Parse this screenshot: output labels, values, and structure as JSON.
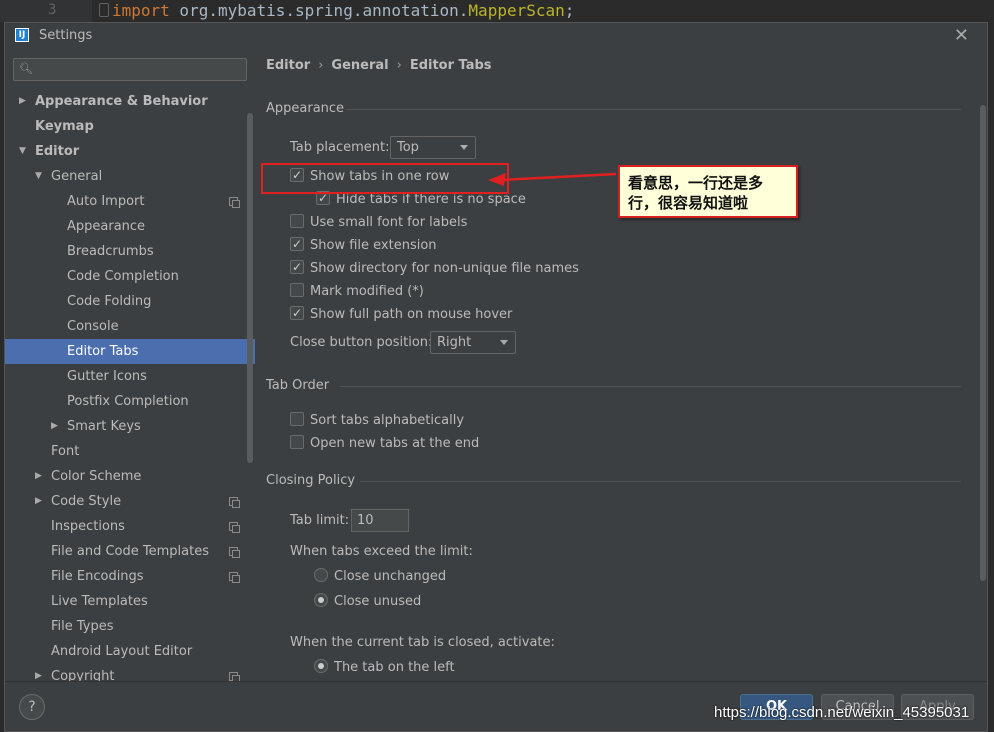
{
  "editor": {
    "line_number": "3",
    "code_keyword": "import",
    "code_package": " org.mybatis.spring.annotation.",
    "code_class": "MapperScan",
    "code_end": ";"
  },
  "window": {
    "title": "Settings",
    "app_icon": "intellij-icon"
  },
  "sidebar": {
    "search_placeholder": "",
    "items": [
      {
        "label": "Appearance & Behavior",
        "level": 0,
        "arrow": "collapsed",
        "bold": true
      },
      {
        "label": "Keymap",
        "level": 0,
        "arrow": "none",
        "bold": true
      },
      {
        "label": "Editor",
        "level": 0,
        "arrow": "expanded",
        "bold": true
      },
      {
        "label": "General",
        "level": 1,
        "arrow": "expanded"
      },
      {
        "label": "Auto Import",
        "level": 2,
        "copy_icon": true
      },
      {
        "label": "Appearance",
        "level": 2
      },
      {
        "label": "Breadcrumbs",
        "level": 2
      },
      {
        "label": "Code Completion",
        "level": 2
      },
      {
        "label": "Code Folding",
        "level": 2
      },
      {
        "label": "Console",
        "level": 2
      },
      {
        "label": "Editor Tabs",
        "level": 2,
        "selected": true
      },
      {
        "label": "Gutter Icons",
        "level": 2
      },
      {
        "label": "Postfix Completion",
        "level": 2
      },
      {
        "label": "Smart Keys",
        "level": 2,
        "arrow": "collapsed"
      },
      {
        "label": "Font",
        "level": 1
      },
      {
        "label": "Color Scheme",
        "level": 1,
        "arrow": "collapsed"
      },
      {
        "label": "Code Style",
        "level": 1,
        "arrow": "collapsed",
        "copy_icon": true
      },
      {
        "label": "Inspections",
        "level": 1,
        "copy_icon": true
      },
      {
        "label": "File and Code Templates",
        "level": 1,
        "copy_icon": true
      },
      {
        "label": "File Encodings",
        "level": 1,
        "copy_icon": true
      },
      {
        "label": "Live Templates",
        "level": 1
      },
      {
        "label": "File Types",
        "level": 1
      },
      {
        "label": "Android Layout Editor",
        "level": 1
      },
      {
        "label": "Copyright",
        "level": 1,
        "arrow": "collapsed",
        "copy_icon": true
      }
    ]
  },
  "breadcrumb": [
    "Editor",
    "General",
    "Editor Tabs"
  ],
  "breadcrumb_separator": "›",
  "appearance": {
    "title": "Appearance",
    "tab_placement_label": "Tab placement:",
    "tab_placement_value": "Top",
    "show_tabs_one_row": {
      "label": "Show tabs in one row",
      "checked": true
    },
    "hide_tabs": {
      "label": "Hide tabs if there is no space",
      "checked": true
    },
    "small_font": {
      "label": "Use small font for labels",
      "checked": false
    },
    "file_extension": {
      "label": "Show file extension",
      "checked": true
    },
    "directory": {
      "label": "Show directory for non-unique file names",
      "checked": true
    },
    "mark_modified": {
      "label": "Mark modified (*)",
      "checked": false
    },
    "full_path": {
      "label": "Show full path on mouse hover",
      "checked": true
    },
    "close_button_label": "Close button position:",
    "close_button_value": "Right"
  },
  "tab_order": {
    "title": "Tab Order",
    "sort_alpha": {
      "label": "Sort tabs alphabetically",
      "checked": false
    },
    "open_end": {
      "label": "Open new tabs at the end",
      "checked": false
    }
  },
  "closing_policy": {
    "title": "Closing Policy",
    "tab_limit_label": "Tab limit:",
    "tab_limit_value": "10",
    "exceed_label": "When tabs exceed the limit:",
    "close_unchanged": {
      "label": "Close unchanged",
      "checked": false
    },
    "close_unused": {
      "label": "Close unused",
      "checked": true
    },
    "activate_label": "When the current tab is closed, activate:",
    "tab_left": {
      "label": "The tab on the left",
      "checked": true
    }
  },
  "annotation": {
    "callout_text": "看意思，一行还是多行，很容易知道啦",
    "highlight_color": "#e02020"
  },
  "footer": {
    "help": "?",
    "ok": "OK",
    "cancel": "Cancel",
    "apply": "Apply"
  },
  "watermark": "https://blog.csdn.net/weixin_45395031",
  "colors": {
    "background": "#3c3f41",
    "selection": "#4b6eaf",
    "ok_button": "#365880",
    "text": "#bbbbbb"
  }
}
